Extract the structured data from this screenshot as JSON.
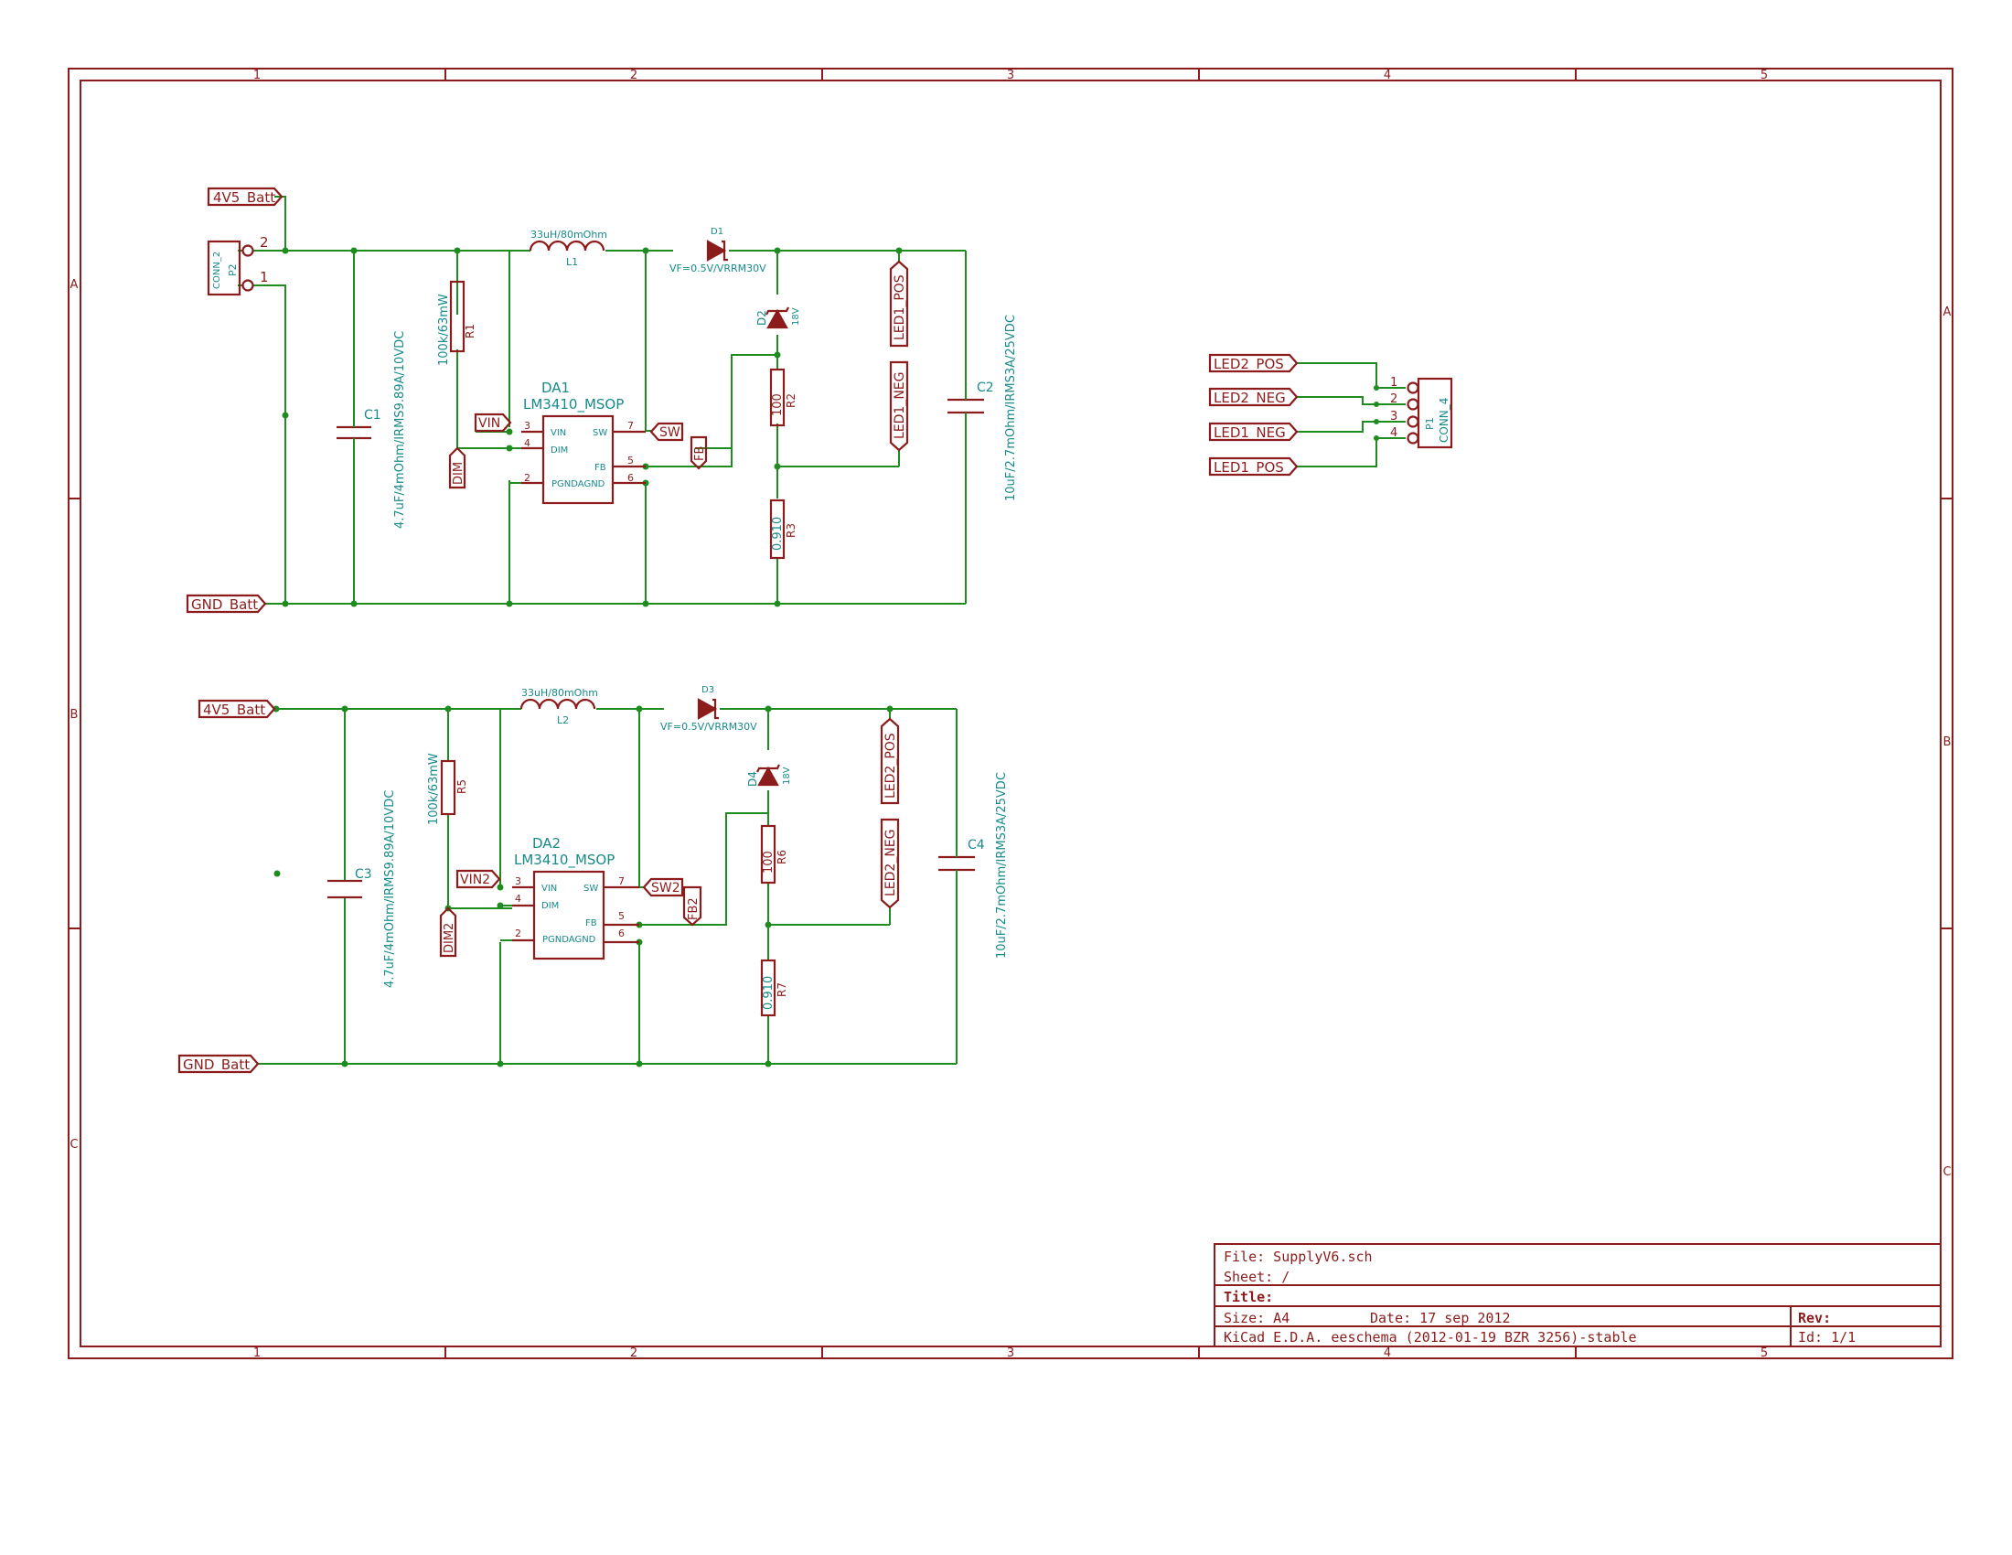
{
  "border": {
    "col_labels": [
      "1",
      "2",
      "3",
      "4",
      "5"
    ],
    "row_labels": [
      "A",
      "B",
      "C"
    ]
  },
  "title_block": {
    "file": "File: SupplyV6.sch",
    "sheet": "Sheet: /",
    "title": "Title:",
    "size": "Size: A4",
    "date": "Date: 17 sep 2012",
    "rev": "Rev:",
    "tool": "KiCad E.D.A.  eeschema (2012-01-19 BZR 3256)-stable",
    "id": "Id: 1/1"
  },
  "circuit1": {
    "batt_label": "4V5_Batt",
    "gnd_label": "GND_Batt",
    "conn_ref": "P2",
    "conn_val": "CONN_2",
    "conn_pins": [
      "2",
      "1"
    ],
    "c_in_ref": "C1",
    "c_in_val": "4.7uF/4mOhm/IRMS9.89A/10VDC",
    "r_dim_ref": "R1",
    "r_dim_val": "100k/63mW",
    "l_ref": "L1",
    "l_val": "33uH/80mOhm",
    "diode_ref": "D1",
    "diode_val": "VF=0.5V/VRRM30V",
    "zener_ref": "D2",
    "zener_val": "18V",
    "r_mid_ref": "R2",
    "r_mid_val": "100",
    "r_sense_ref": "R3",
    "r_sense_val": "0.910",
    "c_out_ref": "C2",
    "c_out_val": "10uF/2.7mOhm/IRMS3A/25VDC",
    "ic_ref": "DA1",
    "ic_val": "LM3410_MSOP",
    "ic_pins": {
      "vin": "VIN",
      "dim": "DIM",
      "sw": "SW",
      "fb": "FB",
      "pgnd": "PGNDAGND"
    },
    "ic_pin_nums": {
      "p3": "3",
      "p4": "4",
      "p2": "2",
      "p7": "7",
      "p5": "5",
      "p6": "6"
    },
    "lbl_vin": "VIN",
    "lbl_dim": "DIM",
    "lbl_sw": "SW",
    "lbl_fb": "FB",
    "lbl_led_pos": "LED1_POS",
    "lbl_led_neg": "LED1_NEG"
  },
  "circuit2": {
    "batt_label": "4V5_Batt",
    "gnd_label": "GND_Batt",
    "c_in_ref": "C3",
    "c_in_val": "4.7uF/4mOhm/IRMS9.89A/10VDC",
    "r_dim_ref": "R5",
    "r_dim_val": "100k/63mW",
    "l_ref": "L2",
    "l_val": "33uH/80mOhm",
    "diode_ref": "D3",
    "diode_val": "VF=0.5V/VRRM30V",
    "zener_ref": "D4",
    "zener_val": "18V",
    "r_mid_ref": "R6",
    "r_mid_val": "100",
    "r_sense_ref": "R7",
    "r_sense_val": "0.910",
    "c_out_ref": "C4",
    "c_out_val": "10uF/2.7mOhm/IRMS3A/25VDC",
    "ic_ref": "DA2",
    "ic_val": "LM3410_MSOP",
    "ic_pins": {
      "vin": "VIN",
      "dim": "DIM",
      "sw": "SW",
      "fb": "FB",
      "pgnd": "PGNDAGND"
    },
    "ic_pin_nums": {
      "p3": "3",
      "p4": "4",
      "p2": "2",
      "p7": "7",
      "p5": "5",
      "p6": "6"
    },
    "lbl_vin": "VIN2",
    "lbl_dim": "DIM2",
    "lbl_sw": "SW2",
    "lbl_fb": "FB2",
    "lbl_led_pos": "LED2_POS",
    "lbl_led_neg": "LED2_NEG"
  },
  "connector": {
    "ref": "P1",
    "val": "CONN_4",
    "pins": [
      "1",
      "2",
      "3",
      "4"
    ],
    "labels": [
      "LED2_POS",
      "LED2_NEG",
      "LED1_NEG",
      "LED1_POS"
    ]
  }
}
